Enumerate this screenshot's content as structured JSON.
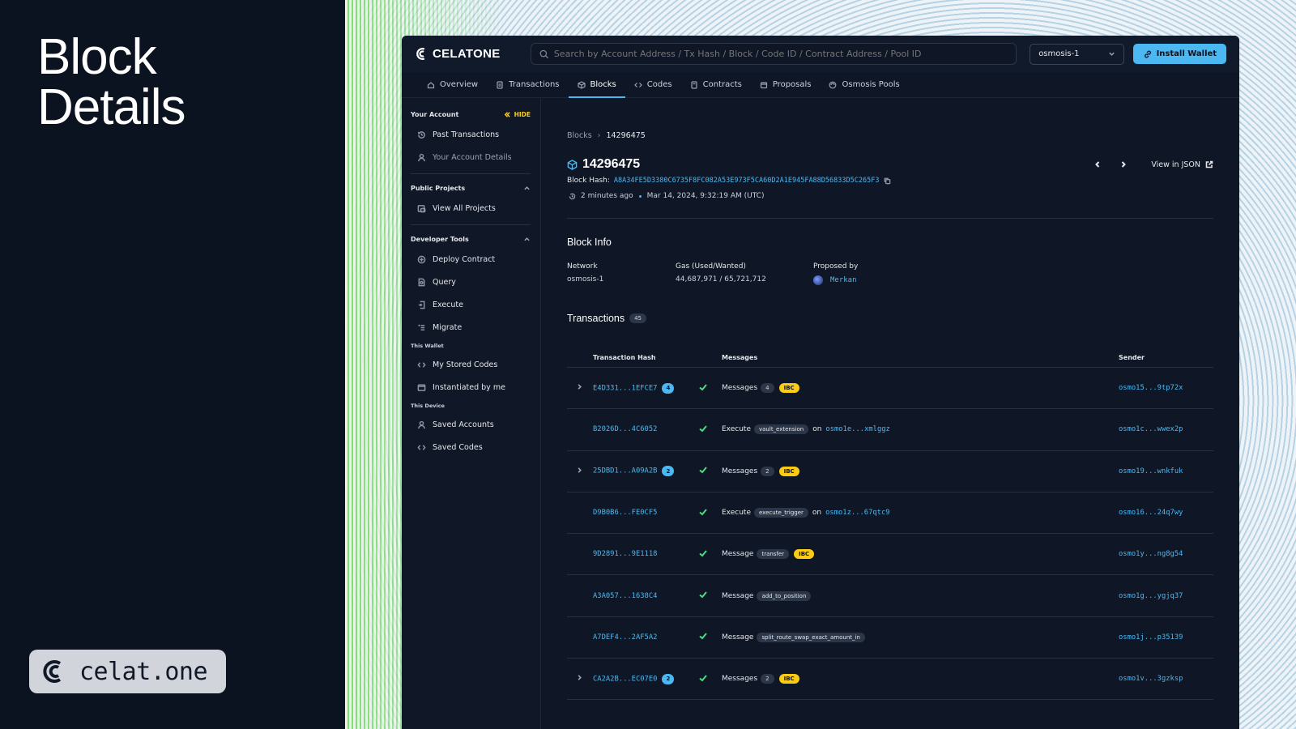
{
  "hero": {
    "line1": "Block",
    "line2": "Details"
  },
  "brand_pill": {
    "text": "celat.one"
  },
  "app": {
    "logo_text": "CELATONE",
    "search": {
      "placeholder": "Search by Account Address / Tx Hash / Block / Code ID / Contract Address / Pool ID"
    },
    "network": "osmosis-1",
    "install_wallet": "Install Wallet",
    "nav": [
      {
        "label": "Overview",
        "icon": "home-icon"
      },
      {
        "label": "Transactions",
        "icon": "document-icon"
      },
      {
        "label": "Blocks",
        "icon": "cube-icon",
        "active": true
      },
      {
        "label": "Codes",
        "icon": "code-icon"
      },
      {
        "label": "Contracts",
        "icon": "contract-icon"
      },
      {
        "label": "Proposals",
        "icon": "proposal-icon"
      },
      {
        "label": "Osmosis Pools",
        "icon": "pool-icon"
      }
    ]
  },
  "sidebar": {
    "your_account": "Your Account",
    "hide": "HIDE",
    "past_transactions": "Past Transactions",
    "your_account_details": "Your Account Details",
    "public_projects": "Public Projects",
    "view_all_projects": "View All Projects",
    "developer_tools": "Developer Tools",
    "deploy_contract": "Deploy Contract",
    "query": "Query",
    "execute": "Execute",
    "migrate": "Migrate",
    "this_wallet": "This Wallet",
    "my_stored_codes": "My Stored Codes",
    "instantiated_by_me": "Instantiated by me",
    "this_device": "This Device",
    "saved_accounts": "Saved Accounts",
    "saved_codes": "Saved Codes"
  },
  "block": {
    "breadcrumb_root": "Blocks",
    "breadcrumb_current": "14296475",
    "height": "14296475",
    "view_json": "View in JSON",
    "hash_label": "Block Hash:",
    "hash": "A8A34FE5D3380C6735F8FC082A53E973F5CA60D2A1E945FA88D56833D5C265F3",
    "time_ago": "2 minutes ago",
    "timestamp": "Mar 14, 2024, 9:32:19 AM (UTC)",
    "info_title": "Block Info",
    "network_label": "Network",
    "network_value": "osmosis-1",
    "gas_label": "Gas (Used/Wanted)",
    "gas_value": "44,687,971 / 65,721,712",
    "proposer_label": "Proposed by",
    "proposer_value": "Merkan"
  },
  "transactions": {
    "title": "Transactions",
    "count": "45",
    "headers": {
      "hash": "Transaction Hash",
      "messages": "Messages",
      "sender": "Sender"
    },
    "rows": [
      {
        "hash": "E4D331...1EFCE7",
        "badge": "4",
        "expand": true,
        "kind": "Messages",
        "count": "4",
        "ibc": "IBC",
        "sender": "osmo15...9tp72x"
      },
      {
        "hash": "B2026D...4C6052",
        "kind": "Execute",
        "tag": "vault_extension",
        "on": "on",
        "target": "osmo1e...xmlggz",
        "sender": "osmo1c...wwex2p"
      },
      {
        "hash": "25DBD1...A09A2B",
        "badge": "2",
        "expand": true,
        "kind": "Messages",
        "count": "2",
        "ibc": "IBC",
        "sender": "osmo19...wnkfuk"
      },
      {
        "hash": "D9B0B6...FE0CF5",
        "kind": "Execute",
        "tag": "execute_trigger",
        "on": "on",
        "target": "osmo1z...67qtc9",
        "sender": "osmo16...24q7wy"
      },
      {
        "hash": "9D2891...9E1118",
        "kind": "Message",
        "tag": "transfer",
        "ibc": "IBC",
        "sender": "osmo1y...ng8g54"
      },
      {
        "hash": "A3A057...1638C4",
        "kind": "Message",
        "tag": "add_to_position",
        "sender": "osmo1g...ygjq37"
      },
      {
        "hash": "A7DEF4...2AF5A2",
        "kind": "Message",
        "tag": "split_route_swap_exact_amount_in",
        "sender": "osmo1j...p35139"
      },
      {
        "hash": "CA2A2B...EC07E0",
        "badge": "2",
        "expand": true,
        "kind": "Messages",
        "count": "2",
        "ibc": "IBC",
        "sender": "osmo1v...3gzksp"
      }
    ]
  }
}
